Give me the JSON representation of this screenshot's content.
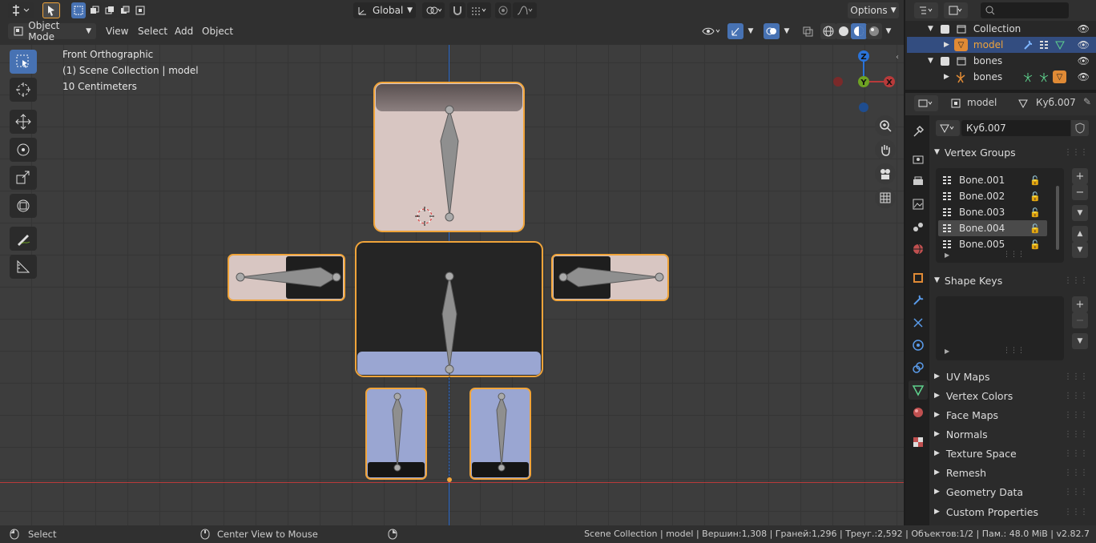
{
  "header": {
    "transform_orientation": "Global",
    "options_label": "Options"
  },
  "viewport_menu": {
    "mode": "Object Mode",
    "items": [
      "View",
      "Select",
      "Add",
      "Object"
    ]
  },
  "overlay_text": {
    "view_name": "Front Orthographic",
    "collection": "(1) Scene Collection | model",
    "scale": "10 Centimeters"
  },
  "gizmo": {
    "z": "Z",
    "y": "Y",
    "x": "X"
  },
  "outliner": {
    "rows": [
      {
        "label": "Collection"
      },
      {
        "label": "model"
      },
      {
        "label": "bones"
      },
      {
        "label": "bones"
      }
    ]
  },
  "properties": {
    "breadcrumb_object": "model",
    "breadcrumb_mesh": "Куб.007",
    "mesh_name": "Куб.007",
    "vertex_groups_title": "Vertex Groups",
    "vertex_groups": [
      "Bone.001",
      "Bone.002",
      "Bone.003",
      "Bone.004",
      "Bone.005"
    ],
    "selected_group": "Bone.004",
    "shape_keys_title": "Shape Keys",
    "collapsed_panels": [
      "UV Maps",
      "Vertex Colors",
      "Face Maps",
      "Normals",
      "Texture Space",
      "Remesh",
      "Geometry Data",
      "Custom Properties"
    ]
  },
  "statusbar": {
    "left_action": "Select",
    "middle_action": "Center View to Mouse",
    "stats": "Scene Collection | model | Вершин:1,308 | Граней:1,296 | Треуг.:2,592 | Объектов:1/2 | Пам.: 48.0 MiB | v2.82.7"
  },
  "colors": {
    "accent": "#4772b3",
    "selection_outline": "#f0a43a",
    "x_axis": "#b83a3a",
    "y_axis": "#6ea223",
    "z_axis": "#2a73d9"
  }
}
